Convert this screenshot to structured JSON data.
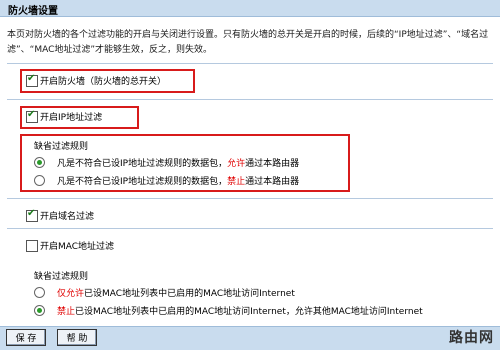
{
  "title": "防火墙设置",
  "intro": "本页对防火墙的各个过滤功能的开启与关闭进行设置。只有防火墙的总开关是开启的时候，后续的“IP地址过滤”、“域名过滤”、“MAC地址过滤”才能够生效，反之，则失效。",
  "firewall": {
    "label": "开启防火墙（防火墙的总开关）",
    "checked": true
  },
  "ip_filter": {
    "label": "开启IP地址过滤",
    "checked": true,
    "default_rule_title": "缺省过滤规则",
    "options": [
      {
        "pre": "凡是不符合已设IP地址过滤规则的数据包，",
        "highlight": "允许",
        "post": "通过本路由器",
        "selected": true
      },
      {
        "pre": "凡是不符合已设IP地址过滤规则的数据包，",
        "highlight": "禁止",
        "post": "通过本路由器",
        "selected": false
      }
    ]
  },
  "domain_filter": {
    "label": "开启域名过滤",
    "checked": true
  },
  "mac_filter": {
    "label": "开启MAC地址过滤",
    "checked": false,
    "default_rule_title": "缺省过滤规则",
    "options": [
      {
        "highlight": "仅允许",
        "post": "已设MAC地址列表中已启用的MAC地址访问Internet",
        "selected": false
      },
      {
        "highlight": "禁止",
        "post": "已设MAC地址列表中已启用的MAC地址访问Internet，允许其他MAC地址访问Internet",
        "selected": true
      }
    ]
  },
  "buttons": {
    "save": "保 存",
    "help": "帮 助"
  },
  "watermark": "路由网",
  "colors": {
    "header_bg": "#c9dcee",
    "highlight": "#e00000",
    "box": "#d81b1b"
  }
}
